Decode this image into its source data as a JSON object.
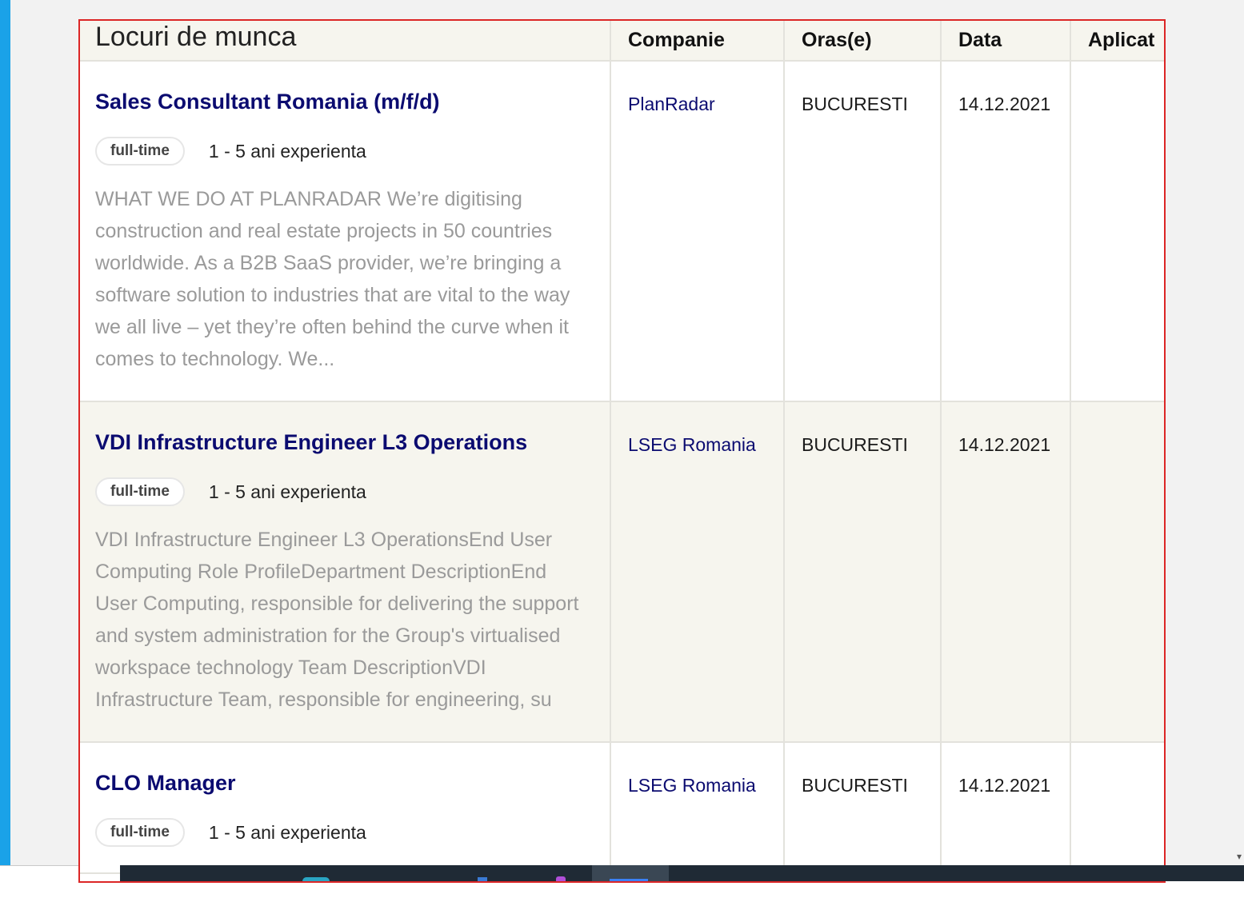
{
  "table": {
    "headers": [
      "Locuri de munca",
      "Companie",
      "Oras(e)",
      "Data",
      "Aplicat"
    ],
    "rows": [
      {
        "title": "Sales Consultant Romania (m/f/d)",
        "tag": "full-time",
        "experience": "1 - 5 ani experienta",
        "description": "WHAT WE DO AT PLANRADAR We’re digitising construction and real estate projects in 50 countries worldwide. As a B2B SaaS provider, we’re bringing a software solution to industries that are vital to the way we all live – yet they’re often behind the curve when it comes to technology. We...",
        "company": "PlanRadar",
        "city": "BUCURESTI",
        "date": "14.12.2021"
      },
      {
        "title": "VDI Infrastructure Engineer L3 Operations",
        "tag": "full-time",
        "experience": "1 - 5 ani experienta",
        "description": "VDI Infrastructure Engineer L3 OperationsEnd User Computing Role ProfileDepartment DescriptionEnd User Computing, responsible for delivering the support and system administration for the Group's virtualised workspace technology Team DescriptionVDI Infrastructure Team, responsible for engineering, su",
        "company": "LSEG Romania",
        "city": "BUCURESTI",
        "date": "14.12.2021"
      },
      {
        "title": "CLO Manager",
        "tag": "full-time",
        "experience": "1 - 5 ani experienta",
        "description": "",
        "company": "LSEG Romania",
        "city": "BUCURESTI",
        "date": "14.12.2021"
      }
    ]
  },
  "colors": {
    "accent": "#1aa2e8",
    "frame_border": "#dc2626",
    "link": "#0b0b70",
    "row_alt": "#f6f5ee"
  },
  "icons": [
    "scroll-down-caret-icon",
    "taskbar-app-icon"
  ],
  "scroll_caret": "▾"
}
